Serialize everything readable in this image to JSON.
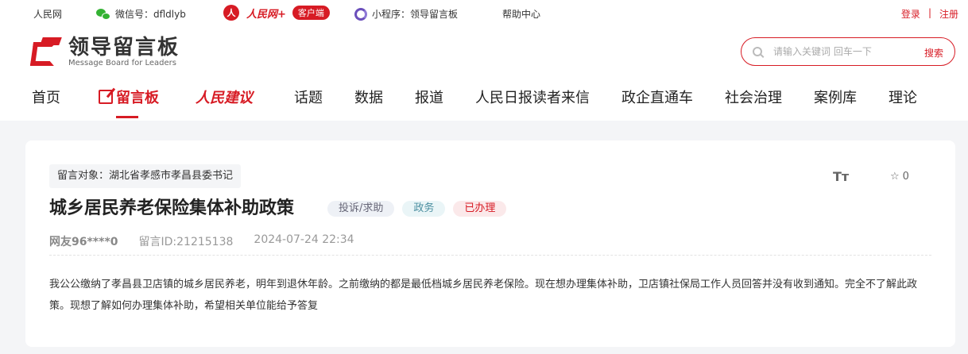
{
  "topbar": {
    "site": "人民网",
    "wechat": "微信号：dfldlyb",
    "rmw_circle": "人",
    "rmw_brand": "人民网+",
    "rmw_pill": "客户端",
    "mini_program": "小程序：领导留言板",
    "help": "帮助中心",
    "login": "登录",
    "separator": "|",
    "register": "注册"
  },
  "logo": {
    "cn": "领导留言板",
    "en": "Message Board for Leaders"
  },
  "search": {
    "placeholder": "请输入关键词 回车一下",
    "button": "搜索"
  },
  "nav": {
    "items": [
      {
        "label": "首页"
      },
      {
        "label": "留言板"
      },
      {
        "label": "人民建议"
      },
      {
        "label": "话题"
      },
      {
        "label": "数据"
      },
      {
        "label": "报道"
      },
      {
        "label": "人民日报读者来信"
      },
      {
        "label": "政企直通车"
      },
      {
        "label": "社会治理"
      },
      {
        "label": "案例库"
      },
      {
        "label": "理论"
      }
    ]
  },
  "message": {
    "target": "留言对象：湖北省孝感市孝昌县委书记",
    "font_toggle": "Tт",
    "star_icon": "☆",
    "star_count": "0",
    "title": "城乡居民养老保险集体补助政策",
    "tags": [
      "投诉/求助",
      "政务",
      "已办理"
    ],
    "author": "网友96****0",
    "message_id": "留言ID:21215138",
    "datetime": "2024-07-24 22:34",
    "content": "我公公缴纳了孝昌县卫店镇的城乡居民养老，明年到退休年龄。之前缴纳的都是最低档城乡居民养老保险。现在想办理集体补助，卫店镇社保局工作人员回答并没有收到通知。完全不了解此政策。现想了解如何办理集体补助，希望相关单位能给予答复"
  },
  "colors": {
    "accent": "#d71b24",
    "background": "#f4f5f7"
  }
}
